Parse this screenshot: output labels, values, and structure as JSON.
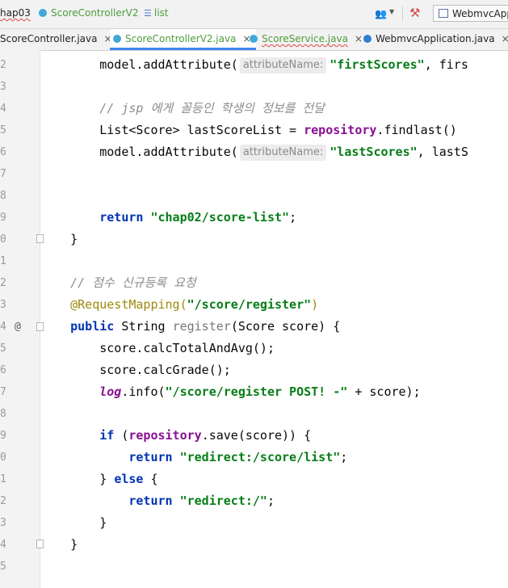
{
  "navbar": {
    "project": "hap03",
    "class": "ScoreControllerV2",
    "method": "list",
    "run_config": "WebmvcApp"
  },
  "tabs": [
    {
      "label": "ScoreController.java",
      "close": "×"
    },
    {
      "label": "ScoreControllerV2.java",
      "close": "×"
    },
    {
      "label": "ScoreService.java",
      "close": "×"
    },
    {
      "label": "WebmvcApplication.java",
      "close": "×"
    }
  ],
  "gutter": {
    "line_numbers": [
      "2",
      "3",
      "4",
      "5",
      "6",
      "7",
      "8",
      "9",
      "0",
      "1",
      "2",
      "3",
      "4",
      "5",
      "6",
      "7",
      "8",
      "9",
      "0",
      "1",
      "2",
      "3",
      "4",
      "5"
    ],
    "annotation_marker": "@"
  },
  "code": {
    "l1": {
      "a": "        model.addAttribute(",
      "hint": "attributeName:",
      "s": "\"firstScores\"",
      "b": ", firs"
    },
    "l3": "        // jsp 에게 꼴등인 학생의 정보를 전달",
    "l4": {
      "a": "        List<Score> lastScoreList = ",
      "f": "repository",
      "b": ".findlast()"
    },
    "l5": {
      "a": "        model.addAttribute(",
      "hint": "attributeName:",
      "s": "\"lastScores\"",
      "b": ", lastS"
    },
    "l8": {
      "k": "        return ",
      "s": "\"chap02/score-list\"",
      "b": ";"
    },
    "l9": "    }",
    "l11": "    // 점수 신규등록 요청",
    "l12": {
      "a": "    @RequestMapping(",
      "s": "\"/score/register\"",
      "b": ")"
    },
    "l13": {
      "k": "    public ",
      "a": "String ",
      "m": "register",
      "b": "(Score score) {"
    },
    "l14": "        score.calcTotalAndAvg();",
    "l15": "        score.calcGrade();",
    "l16": {
      "l": "        log",
      "a": ".info(",
      "s": "\"/score/register POST! -\"",
      "b": " + score);"
    },
    "l18": {
      "k": "        if ",
      "a": "(",
      "f": "repository",
      "b": ".save(score)) {"
    },
    "l19": {
      "k": "            return ",
      "s": "\"redirect:/score/list\"",
      "b": ";"
    },
    "l20": {
      "a": "        } ",
      "k": "else",
      "b": " {"
    },
    "l21": {
      "k": "            return ",
      "s": "\"redirect:/\"",
      "b": ";"
    },
    "l22": "        }",
    "l23": "    }"
  },
  "colors": {
    "keyword": "#0033b3",
    "string": "#067d17",
    "comment": "#8c8c8c",
    "annotation": "#9e880d",
    "field": "#871094",
    "active_tab_underline": "#4285f4"
  }
}
